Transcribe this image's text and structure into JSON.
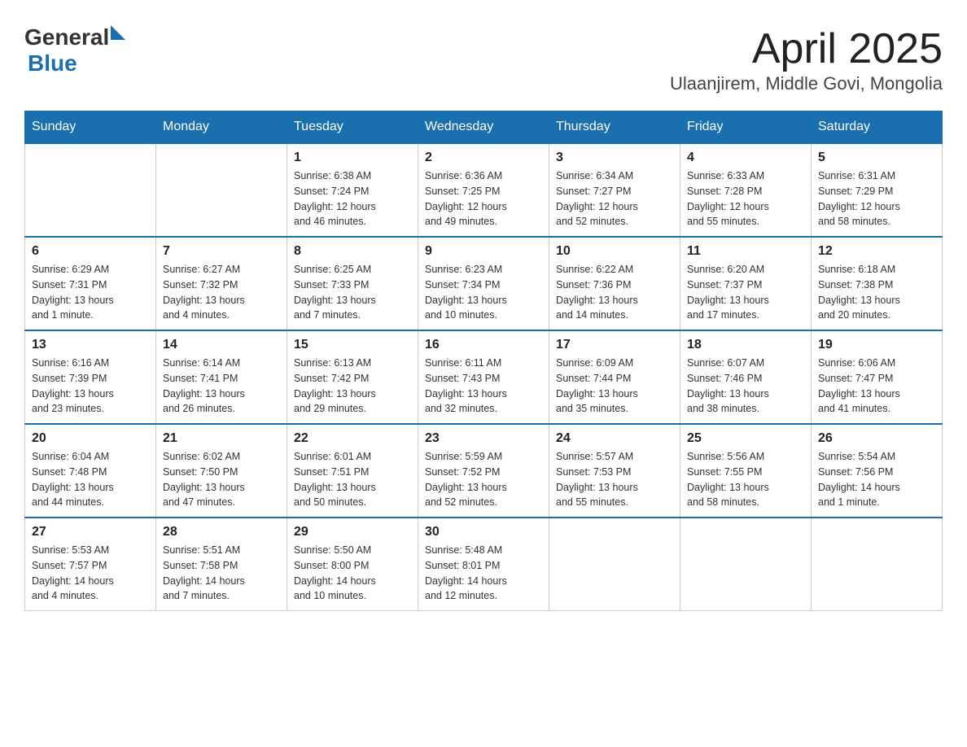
{
  "header": {
    "logo": {
      "general": "General",
      "blue": "Blue"
    },
    "title": "April 2025",
    "subtitle": "Ulaanjirem, Middle Govi, Mongolia"
  },
  "weekdays": [
    "Sunday",
    "Monday",
    "Tuesday",
    "Wednesday",
    "Thursday",
    "Friday",
    "Saturday"
  ],
  "weeks": [
    [
      {
        "day": "",
        "info": ""
      },
      {
        "day": "",
        "info": ""
      },
      {
        "day": "1",
        "info": "Sunrise: 6:38 AM\nSunset: 7:24 PM\nDaylight: 12 hours\nand 46 minutes."
      },
      {
        "day": "2",
        "info": "Sunrise: 6:36 AM\nSunset: 7:25 PM\nDaylight: 12 hours\nand 49 minutes."
      },
      {
        "day": "3",
        "info": "Sunrise: 6:34 AM\nSunset: 7:27 PM\nDaylight: 12 hours\nand 52 minutes."
      },
      {
        "day": "4",
        "info": "Sunrise: 6:33 AM\nSunset: 7:28 PM\nDaylight: 12 hours\nand 55 minutes."
      },
      {
        "day": "5",
        "info": "Sunrise: 6:31 AM\nSunset: 7:29 PM\nDaylight: 12 hours\nand 58 minutes."
      }
    ],
    [
      {
        "day": "6",
        "info": "Sunrise: 6:29 AM\nSunset: 7:31 PM\nDaylight: 13 hours\nand 1 minute."
      },
      {
        "day": "7",
        "info": "Sunrise: 6:27 AM\nSunset: 7:32 PM\nDaylight: 13 hours\nand 4 minutes."
      },
      {
        "day": "8",
        "info": "Sunrise: 6:25 AM\nSunset: 7:33 PM\nDaylight: 13 hours\nand 7 minutes."
      },
      {
        "day": "9",
        "info": "Sunrise: 6:23 AM\nSunset: 7:34 PM\nDaylight: 13 hours\nand 10 minutes."
      },
      {
        "day": "10",
        "info": "Sunrise: 6:22 AM\nSunset: 7:36 PM\nDaylight: 13 hours\nand 14 minutes."
      },
      {
        "day": "11",
        "info": "Sunrise: 6:20 AM\nSunset: 7:37 PM\nDaylight: 13 hours\nand 17 minutes."
      },
      {
        "day": "12",
        "info": "Sunrise: 6:18 AM\nSunset: 7:38 PM\nDaylight: 13 hours\nand 20 minutes."
      }
    ],
    [
      {
        "day": "13",
        "info": "Sunrise: 6:16 AM\nSunset: 7:39 PM\nDaylight: 13 hours\nand 23 minutes."
      },
      {
        "day": "14",
        "info": "Sunrise: 6:14 AM\nSunset: 7:41 PM\nDaylight: 13 hours\nand 26 minutes."
      },
      {
        "day": "15",
        "info": "Sunrise: 6:13 AM\nSunset: 7:42 PM\nDaylight: 13 hours\nand 29 minutes."
      },
      {
        "day": "16",
        "info": "Sunrise: 6:11 AM\nSunset: 7:43 PM\nDaylight: 13 hours\nand 32 minutes."
      },
      {
        "day": "17",
        "info": "Sunrise: 6:09 AM\nSunset: 7:44 PM\nDaylight: 13 hours\nand 35 minutes."
      },
      {
        "day": "18",
        "info": "Sunrise: 6:07 AM\nSunset: 7:46 PM\nDaylight: 13 hours\nand 38 minutes."
      },
      {
        "day": "19",
        "info": "Sunrise: 6:06 AM\nSunset: 7:47 PM\nDaylight: 13 hours\nand 41 minutes."
      }
    ],
    [
      {
        "day": "20",
        "info": "Sunrise: 6:04 AM\nSunset: 7:48 PM\nDaylight: 13 hours\nand 44 minutes."
      },
      {
        "day": "21",
        "info": "Sunrise: 6:02 AM\nSunset: 7:50 PM\nDaylight: 13 hours\nand 47 minutes."
      },
      {
        "day": "22",
        "info": "Sunrise: 6:01 AM\nSunset: 7:51 PM\nDaylight: 13 hours\nand 50 minutes."
      },
      {
        "day": "23",
        "info": "Sunrise: 5:59 AM\nSunset: 7:52 PM\nDaylight: 13 hours\nand 52 minutes."
      },
      {
        "day": "24",
        "info": "Sunrise: 5:57 AM\nSunset: 7:53 PM\nDaylight: 13 hours\nand 55 minutes."
      },
      {
        "day": "25",
        "info": "Sunrise: 5:56 AM\nSunset: 7:55 PM\nDaylight: 13 hours\nand 58 minutes."
      },
      {
        "day": "26",
        "info": "Sunrise: 5:54 AM\nSunset: 7:56 PM\nDaylight: 14 hours\nand 1 minute."
      }
    ],
    [
      {
        "day": "27",
        "info": "Sunrise: 5:53 AM\nSunset: 7:57 PM\nDaylight: 14 hours\nand 4 minutes."
      },
      {
        "day": "28",
        "info": "Sunrise: 5:51 AM\nSunset: 7:58 PM\nDaylight: 14 hours\nand 7 minutes."
      },
      {
        "day": "29",
        "info": "Sunrise: 5:50 AM\nSunset: 8:00 PM\nDaylight: 14 hours\nand 10 minutes."
      },
      {
        "day": "30",
        "info": "Sunrise: 5:48 AM\nSunset: 8:01 PM\nDaylight: 14 hours\nand 12 minutes."
      },
      {
        "day": "",
        "info": ""
      },
      {
        "day": "",
        "info": ""
      },
      {
        "day": "",
        "info": ""
      }
    ]
  ]
}
